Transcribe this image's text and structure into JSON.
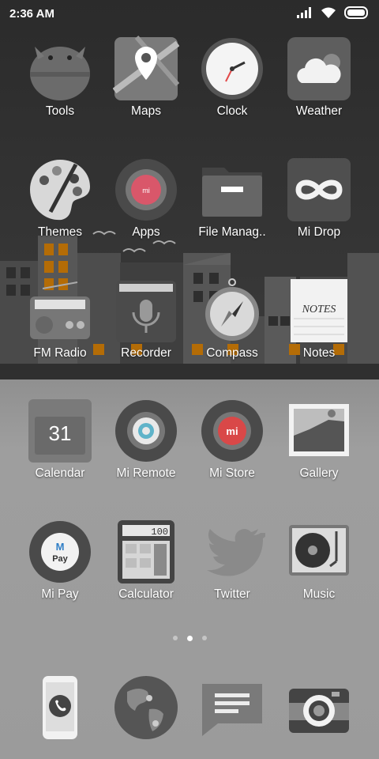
{
  "status_bar": {
    "time": "2:36 AM"
  },
  "apps_row1": [
    {
      "id": "tools",
      "label": "Tools",
      "icon": "tools-icon"
    },
    {
      "id": "maps",
      "label": "Maps",
      "icon": "maps-icon"
    },
    {
      "id": "clock",
      "label": "Clock",
      "icon": "clock-icon"
    },
    {
      "id": "weather",
      "label": "Weather",
      "icon": "weather-icon"
    }
  ],
  "apps_row2": [
    {
      "id": "themes",
      "label": "Themes",
      "icon": "palette-icon"
    },
    {
      "id": "apps",
      "label": "Apps",
      "icon": "apps-icon"
    },
    {
      "id": "file-manager",
      "label": "File Manag..",
      "icon": "folder-icon"
    },
    {
      "id": "mi-drop",
      "label": "Mi Drop",
      "icon": "infinity-icon"
    }
  ],
  "apps_row3": [
    {
      "id": "fm-radio",
      "label": "FM Radio",
      "icon": "radio-icon"
    },
    {
      "id": "recorder",
      "label": "Recorder",
      "icon": "microphone-icon"
    },
    {
      "id": "compass",
      "label": "Compass",
      "icon": "compass-icon"
    },
    {
      "id": "notes",
      "label": "Notes",
      "icon": "notes-icon",
      "icon_text": "NOTES"
    }
  ],
  "apps_row4": [
    {
      "id": "calendar",
      "label": "Calendar",
      "icon": "calendar-icon",
      "icon_text": "31"
    },
    {
      "id": "mi-remote",
      "label": "Mi Remote",
      "icon": "remote-icon"
    },
    {
      "id": "mi-store",
      "label": "Mi Store",
      "icon": "store-icon",
      "icon_text": "mi"
    },
    {
      "id": "gallery",
      "label": "Gallery",
      "icon": "gallery-icon"
    }
  ],
  "apps_row5": [
    {
      "id": "mi-pay",
      "label": "Mi Pay",
      "icon": "mipay-icon",
      "icon_text": "Pay"
    },
    {
      "id": "calculator",
      "label": "Calculator",
      "icon": "calculator-icon",
      "icon_text": "100"
    },
    {
      "id": "twitter",
      "label": "Twitter",
      "icon": "twitter-icon"
    },
    {
      "id": "music",
      "label": "Music",
      "icon": "turntable-icon"
    }
  ],
  "page_indicator": {
    "count": 3,
    "active_index": 1
  },
  "dock": [
    {
      "id": "phone",
      "icon": "phone-icon"
    },
    {
      "id": "browser",
      "icon": "globe-icon"
    },
    {
      "id": "messaging",
      "icon": "message-icon"
    },
    {
      "id": "camera",
      "icon": "camera-icon"
    }
  ]
}
